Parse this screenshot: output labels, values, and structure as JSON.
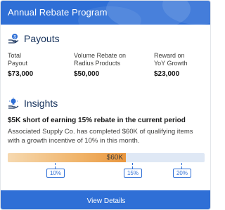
{
  "header": {
    "title": "Annual Rebate Program"
  },
  "payouts": {
    "title": "Payouts",
    "icon": "payout-hand-coin-icon",
    "metrics": [
      {
        "label_line1": "Total",
        "label_line2": "Payout",
        "value": "$73,000"
      },
      {
        "label_line1": "Volume Rebate on",
        "label_line2": "Radius Products",
        "value": "$50,000"
      },
      {
        "label_line1": "Reward on",
        "label_line2": "YoY Growth",
        "value": "$23,000"
      }
    ]
  },
  "insights": {
    "title": "Insights",
    "icon": "insights-lightbulb-hand-icon",
    "headline": "$5K short of earning 15% rebate in the current period",
    "description": "Associated Supply Co. has completed $60K of qualifying items with a growth incentive of 10% in this month.",
    "progress": {
      "value_label": "$60K",
      "fill_fraction": 0.6,
      "thresholds": [
        {
          "label": "10%",
          "fraction": 0.24
        },
        {
          "label": "15%",
          "fraction": 0.632
        },
        {
          "label": "20%",
          "fraction": 0.883
        }
      ]
    }
  },
  "footer": {
    "button_label": "View Details"
  },
  "colors": {
    "brand": "#2f6fd6",
    "progress_fill": "#f0b46a",
    "progress_track": "#dfe8f5"
  }
}
